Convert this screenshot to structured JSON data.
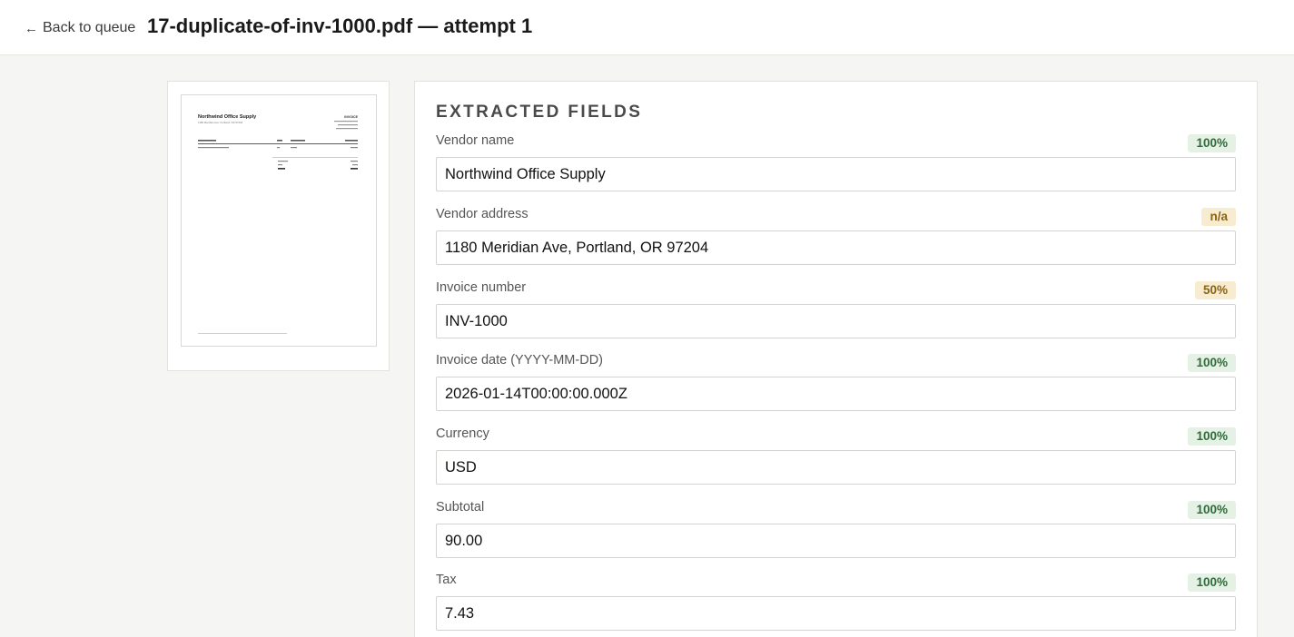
{
  "header": {
    "back_label": "Back to queue",
    "back_icon": "arrow-left-icon",
    "title": "17-duplicate-of-inv-1000.pdf — attempt 1"
  },
  "preview": {
    "vendor": "Northwind Office Supply",
    "address": "1180 Meridian Ave, Portland, OR 97204",
    "doc_label": "INVOICE"
  },
  "fields_section": {
    "title": "EXTRACTED FIELDS",
    "fields": [
      {
        "label": "Vendor name",
        "confidence": "100%",
        "level": "high",
        "value": "Northwind Office Supply"
      },
      {
        "label": "Vendor address",
        "confidence": "n/a",
        "level": "na",
        "value": "1180 Meridian Ave, Portland, OR 97204"
      },
      {
        "label": "Invoice number",
        "confidence": "50%",
        "level": "mid",
        "value": "INV-1000"
      },
      {
        "label": "Invoice date (YYYY-MM-DD)",
        "confidence": "100%",
        "level": "high",
        "value": "2026-01-14T00:00:00.000Z"
      },
      {
        "label": "Currency",
        "confidence": "100%",
        "level": "high",
        "value": "USD"
      },
      {
        "label": "Subtotal",
        "confidence": "100%",
        "level": "high",
        "value": "90.00"
      },
      {
        "label": "Tax",
        "confidence": "100%",
        "level": "high",
        "value": "7.43"
      }
    ]
  },
  "colors": {
    "confidence_high_bg": "#e4f1e4",
    "confidence_high_text": "#2f6b3a",
    "confidence_warn_bg": "#f7eccf",
    "confidence_warn_text": "#8a6316"
  }
}
